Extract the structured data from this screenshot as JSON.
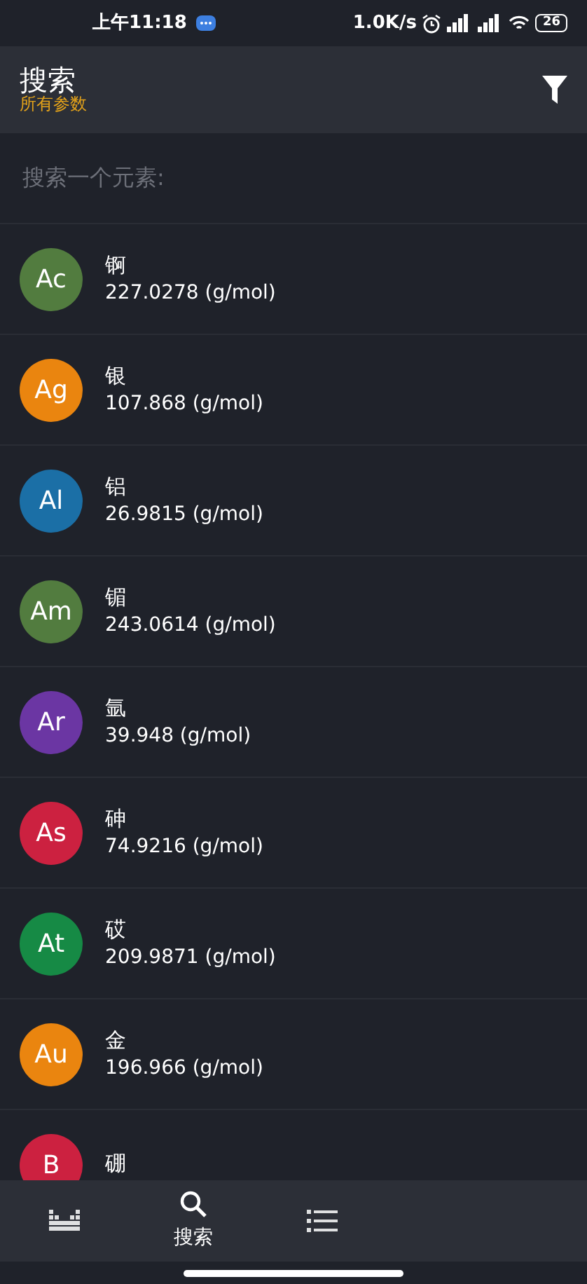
{
  "status_bar": {
    "time": "上午11:18",
    "speed": "1.0K/s",
    "battery": "26"
  },
  "app_bar": {
    "title": "搜索",
    "subtitle": "所有参数"
  },
  "search": {
    "placeholder": "搜索一个元素:"
  },
  "elements": [
    {
      "symbol": "Ac",
      "name": "锕",
      "mass": "227.0278 (g/mol)",
      "color": "#527c3f"
    },
    {
      "symbol": "Ag",
      "name": "银",
      "mass": "107.868 (g/mol)",
      "color": "#ea850f"
    },
    {
      "symbol": "Al",
      "name": "铝",
      "mass": "26.9815 (g/mol)",
      "color": "#1b6fa6"
    },
    {
      "symbol": "Am",
      "name": "镅",
      "mass": "243.0614 (g/mol)",
      "color": "#527c3f"
    },
    {
      "symbol": "Ar",
      "name": "氩",
      "mass": "39.948 (g/mol)",
      "color": "#6b36a3"
    },
    {
      "symbol": "As",
      "name": "砷",
      "mass": "74.9216 (g/mol)",
      "color": "#cc2140"
    },
    {
      "symbol": "At",
      "name": "砹",
      "mass": "209.9871 (g/mol)",
      "color": "#168a45"
    },
    {
      "symbol": "Au",
      "name": "金",
      "mass": "196.966 (g/mol)",
      "color": "#ea850f"
    },
    {
      "symbol": "B",
      "name": "硼",
      "color": "#cc2140"
    }
  ],
  "bottom_nav": [
    {
      "kind": "table",
      "selected": false
    },
    {
      "kind": "search",
      "label": "搜索",
      "selected": true
    },
    {
      "kind": "list",
      "selected": false
    }
  ]
}
